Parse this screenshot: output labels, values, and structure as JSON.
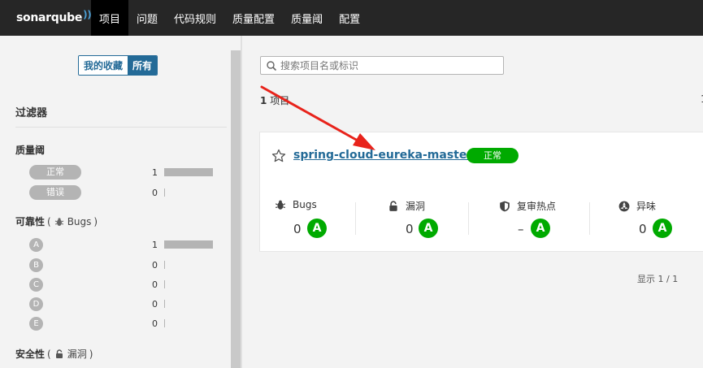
{
  "nav": {
    "logo": "sonarqube",
    "items": [
      {
        "label": "项目",
        "active": true
      },
      {
        "label": "问题"
      },
      {
        "label": "代码规则"
      },
      {
        "label": "质量配置"
      },
      {
        "label": "质量阈"
      },
      {
        "label": "配置"
      }
    ]
  },
  "sidebar": {
    "toggle": {
      "favorites": "我的收藏",
      "all": "所有"
    },
    "filters_title": "过滤器",
    "quality_gate": {
      "title": "质量阈",
      "options": [
        {
          "label": "正常",
          "count": "1",
          "fraction": 1.0
        },
        {
          "label": "错误",
          "count": "0",
          "fraction": 0.0
        }
      ]
    },
    "reliability": {
      "title": "可靠性",
      "paren_open": "(",
      "sub": "Bugs",
      "paren_close": ")",
      "options": [
        {
          "label": "A",
          "count": "1",
          "fraction": 1.0
        },
        {
          "label": "B",
          "count": "0",
          "fraction": 0.0
        },
        {
          "label": "C",
          "count": "0",
          "fraction": 0.0
        },
        {
          "label": "D",
          "count": "0",
          "fraction": 0.0
        },
        {
          "label": "E",
          "count": "0",
          "fraction": 0.0
        }
      ]
    },
    "security": {
      "title": "安全性",
      "paren_open": "(",
      "sub": "漏洞",
      "paren_close": ")"
    }
  },
  "main": {
    "search_placeholder": "搜索项目名或标识",
    "count_number": "1",
    "count_label": "项目",
    "edge_char": "1",
    "project": {
      "name": "spring-cloud-eureka-master",
      "status": "正常",
      "metrics": [
        {
          "label": "Bugs",
          "icon": "bug-icon",
          "value": "0",
          "grade": "A"
        },
        {
          "label": "漏洞",
          "icon": "lock-icon",
          "value": "0",
          "grade": "A"
        },
        {
          "label": "复审热点",
          "icon": "shield-icon",
          "value": "–",
          "grade": "A"
        },
        {
          "label": "异味",
          "icon": "smell-icon",
          "value": "0",
          "grade": "A"
        }
      ]
    },
    "pager": "显示 1 / 1"
  },
  "colors": {
    "nav_bg": "#262626",
    "accent": "#236a97",
    "ok": "#00aa00",
    "facet_grey": "#b4b4b4",
    "annotation": "#e8231b"
  }
}
